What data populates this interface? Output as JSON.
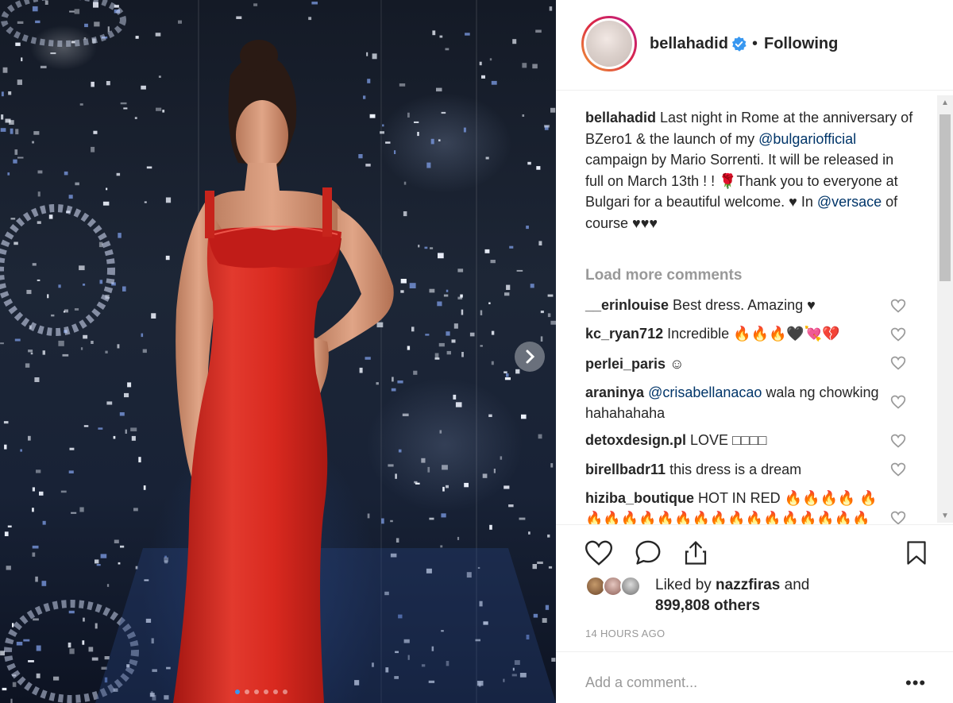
{
  "post": {
    "username": "bellahadid",
    "separator": "•",
    "follow_status": "Following"
  },
  "caption": {
    "username": "bellahadid",
    "part1": " Last night in Rome at the anniversary of BZero1 & the launch of my ",
    "mention1": "@bulgariofficial",
    "part2": " campaign by Mario Sorrenti. It will be released in full on March 13th ! ! 🌹Thank you to everyone at Bulgari for a beautiful welcome. ♥ In ",
    "mention2": "@versace",
    "part3": " of course ♥♥♥"
  },
  "load_more_label": "Load more comments",
  "comments": [
    {
      "user": "__erinlouise",
      "text": " Best dress. Amazing ♥"
    },
    {
      "user": "kc_ryan712",
      "text": " Incredible 🔥🔥🔥🖤💘💔"
    },
    {
      "user": "perlei_paris",
      "text": " ☺"
    },
    {
      "user": "araninya",
      "pre": " ",
      "mention": "@crisabellanacao",
      "text": " wala ng chowking hahahahaha"
    },
    {
      "user": "detoxdesign.pl",
      "text": " LOVE □□□□"
    },
    {
      "user": "birellbadr11",
      "text": " this dress is a dream"
    },
    {
      "user": "hiziba_boutique",
      "text": " HOT IN RED 🔥🔥🔥🔥 🔥🔥🔥🔥🔥🔥🔥🔥🔥🔥🔥🔥🔥🔥🔥🔥🔥🔥🔥🔥"
    }
  ],
  "likes": {
    "prefix": "Liked by ",
    "user": "nazzfiras",
    "suffix": " and",
    "count_line": "899,808 others"
  },
  "timestamp": "14 HOURS AGO",
  "add_comment_placeholder": "Add a comment...",
  "more_label": "•••",
  "icons": {
    "verified": "verified-badge-icon",
    "like": "heart-icon",
    "comment": "comment-icon",
    "share": "share-icon",
    "save": "bookmark-icon",
    "next": "chevron-right-icon"
  },
  "colors": {
    "verified": "#3897f0",
    "mention": "#003569",
    "secondary_text": "#999999",
    "dress_red": "#d9291f"
  },
  "carousel": {
    "count": 6,
    "active": 1
  }
}
